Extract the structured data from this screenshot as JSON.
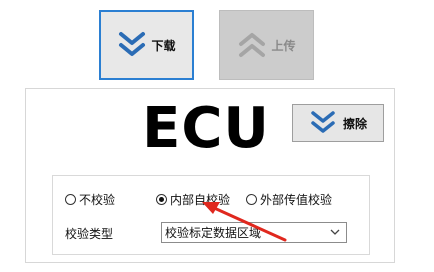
{
  "toolbar": {
    "download_label": "下载",
    "upload_label": "上传"
  },
  "panel": {
    "title": "ECU",
    "erase_label": "擦除"
  },
  "check": {
    "options": [
      {
        "label": "不校验",
        "selected": false
      },
      {
        "label": "内部自校验",
        "selected": true
      },
      {
        "label": "外部传值校验",
        "selected": false
      }
    ],
    "type_label": "校验类型",
    "type_value": "校验标定数据区域"
  },
  "icons": {
    "download": "double-chevron-down-icon",
    "upload": "double-chevron-up-icon",
    "erase": "double-chevron-down-icon",
    "dropdown": "chevron-down-icon"
  },
  "colors": {
    "accent": "#2b7fd2",
    "annotation": "#e0281e"
  }
}
